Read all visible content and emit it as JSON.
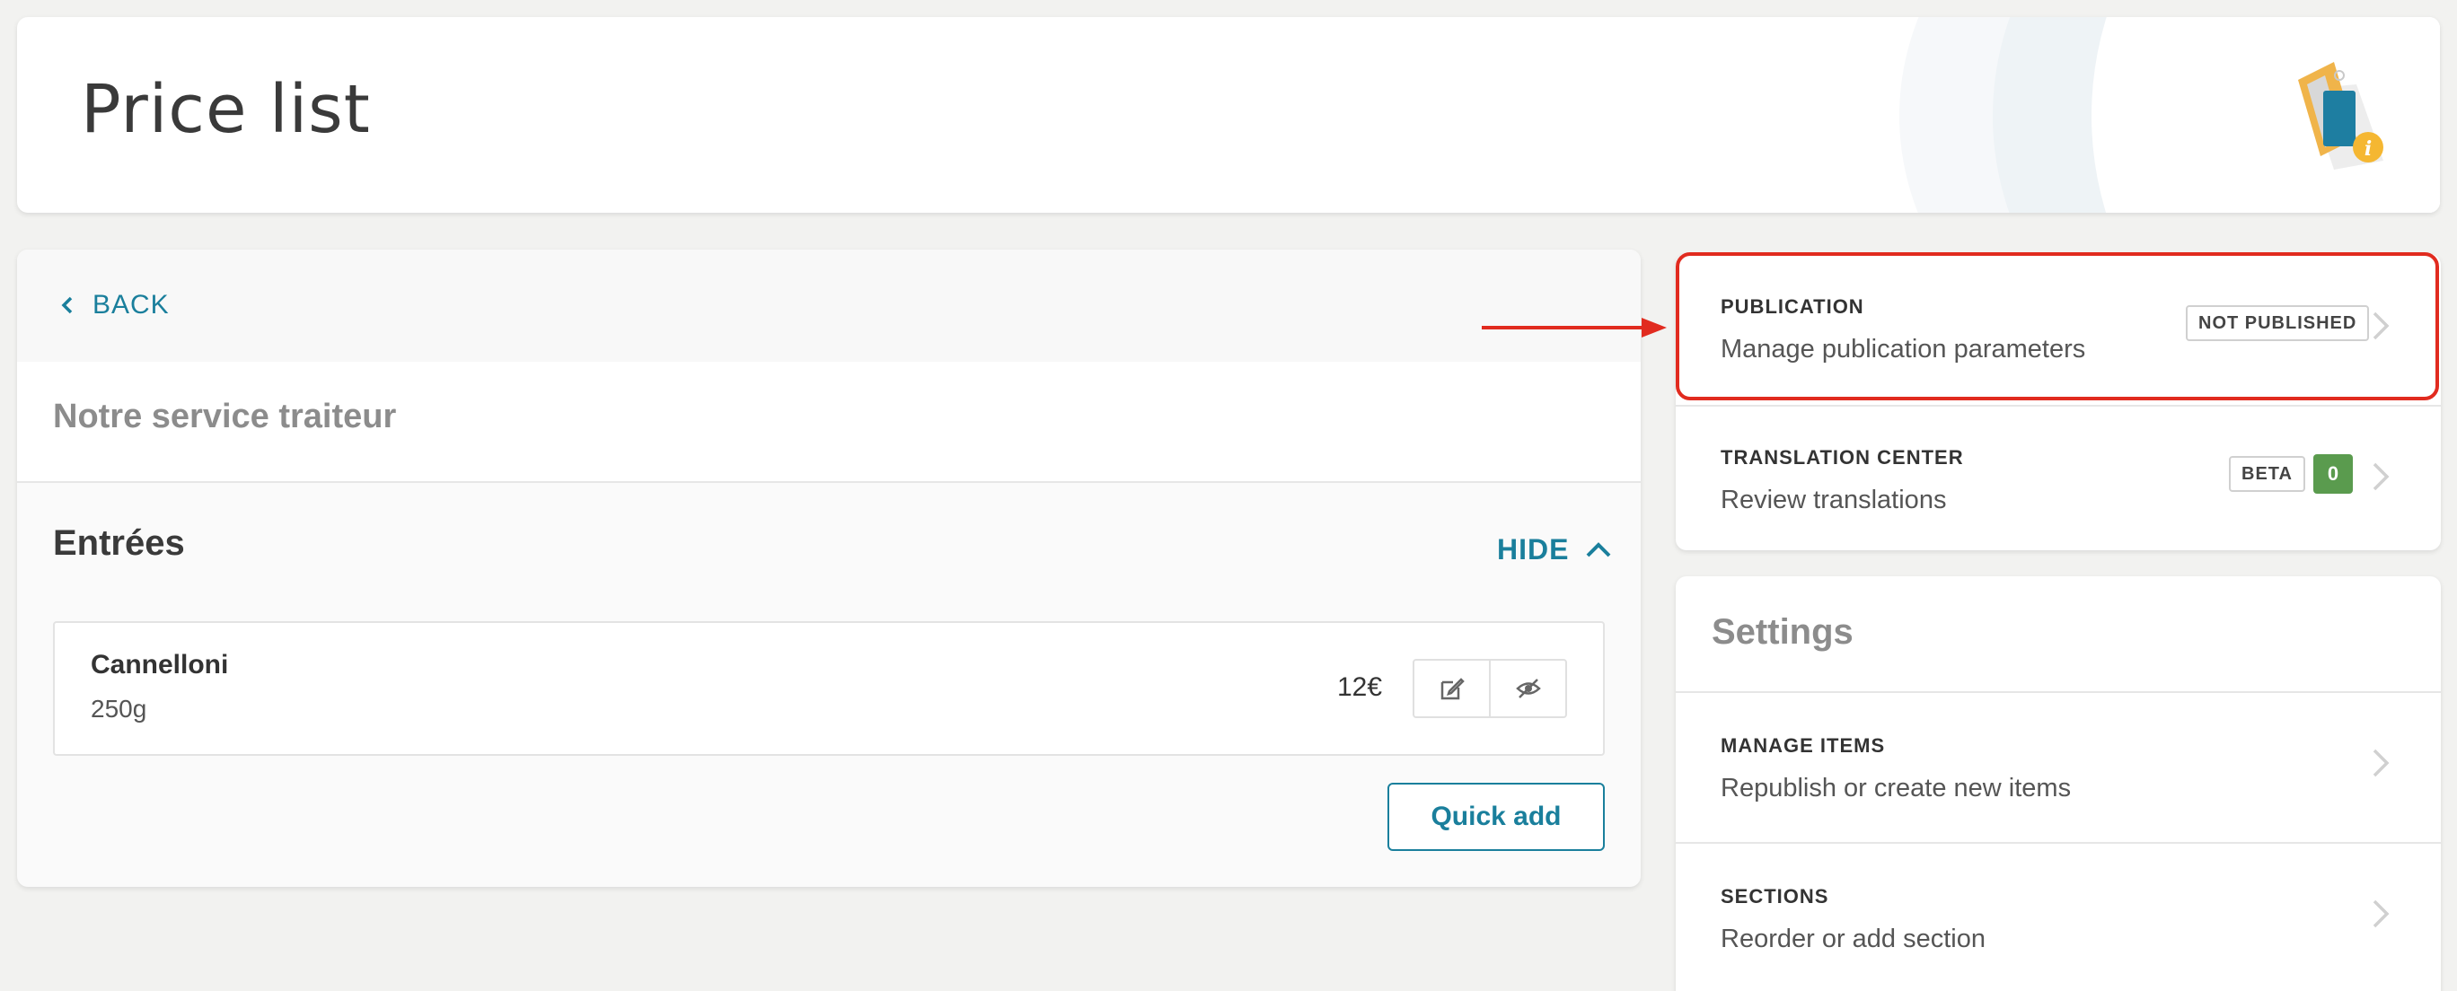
{
  "header": {
    "title": "Price list",
    "icon": "price-tag-info-icon"
  },
  "left": {
    "back_label": "BACK",
    "service_title": "Notre service traiteur",
    "section": {
      "title": "Entrées",
      "toggle_label": "HIDE",
      "items": [
        {
          "name": "Cannelloni",
          "weight": "250g",
          "price": "12€"
        }
      ]
    },
    "quick_add_label": "Quick add"
  },
  "right": {
    "publication": {
      "label": "PUBLICATION",
      "desc": "Manage publication parameters",
      "status": "NOT PUBLISHED"
    },
    "translation": {
      "label": "TRANSLATION CENTER",
      "desc": "Review translations",
      "beta": "BETA",
      "count": "0"
    },
    "settings": {
      "title": "Settings",
      "rows": [
        {
          "label": "MANAGE ITEMS",
          "desc": "Republish or create new items"
        },
        {
          "label": "SECTIONS",
          "desc": "Reorder or add section"
        }
      ]
    }
  },
  "colors": {
    "accent": "#1a7f9c",
    "highlight": "#e12b1f",
    "count_badge": "#5a9b4e"
  }
}
